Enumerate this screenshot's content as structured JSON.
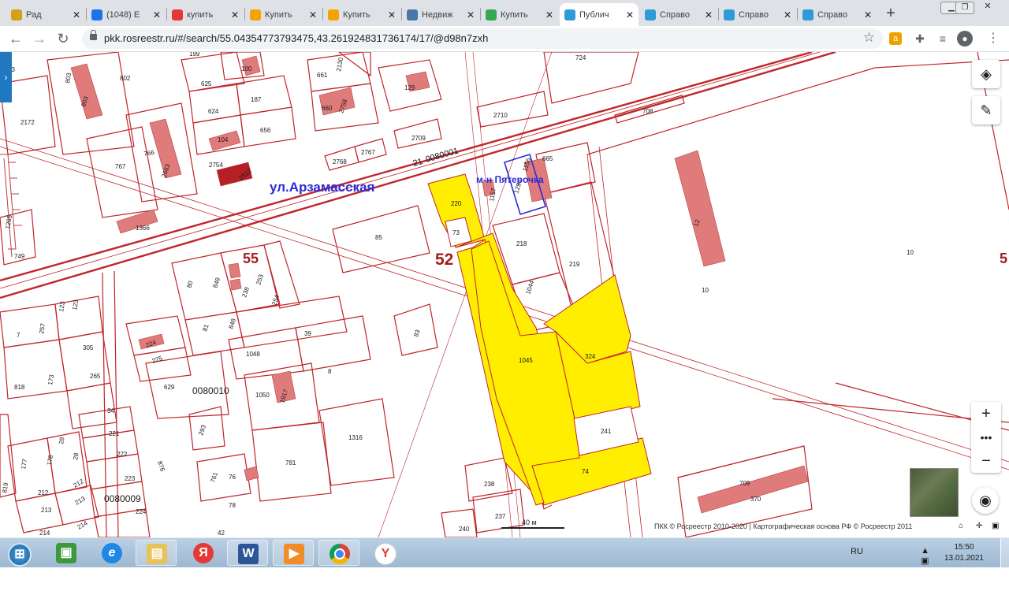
{
  "tabs": [
    {
      "label": "Рад",
      "icon_color": "#d4a017",
      "icon": "audio-tab-icon"
    },
    {
      "label": "(1048) E",
      "icon_color": "#1a73e8",
      "icon": "mail-icon"
    },
    {
      "label": "купить",
      "icon_color": "#e53935",
      "icon": "yandex-icon"
    },
    {
      "label": "Купить",
      "icon_color": "#f4a300",
      "icon": "house-icon"
    },
    {
      "label": "Купить",
      "icon_color": "#f4a300",
      "icon": "house-icon"
    },
    {
      "label": "Недвиж",
      "icon_color": "#4a76a8",
      "icon": "vk-icon"
    },
    {
      "label": "Купить",
      "icon_color": "#34a853",
      "icon": "grid-icon"
    },
    {
      "label": "Публич",
      "icon_color": "#2e9bd6",
      "icon": "rosreestr-icon"
    },
    {
      "label": "Справо",
      "icon_color": "#2e9bd6",
      "icon": "rosreestr-icon"
    },
    {
      "label": "Справо",
      "icon_color": "#2e9bd6",
      "icon": "rosreestr-icon"
    },
    {
      "label": "Справо",
      "icon_color": "#2e9bd6",
      "icon": "rosreestr-icon"
    }
  ],
  "active_tab_index": 7,
  "toolbar": {
    "url": "pkk.rosreestr.ru/#/search/55.04354773793475,43.261924831736174/17/@d98n7zxh"
  },
  "map": {
    "street_label": "ул.Арзамасская",
    "shop_label": "м-н Пятерочка",
    "quarter_labels": [
      "0080001",
      "0080010",
      "0080009"
    ],
    "big_numbers": [
      "52",
      "55",
      "5"
    ],
    "parcels": [
      "220",
      "73",
      "1157",
      "1156",
      "1294",
      "665",
      "218",
      "219",
      "1044",
      "1045",
      "324",
      "241",
      "74",
      "238",
      "237",
      "240",
      "85",
      "83",
      "12",
      "10",
      "10",
      "709",
      "370",
      "708",
      "2710",
      "724",
      "2709",
      "2768",
      "2767",
      "129",
      "661",
      "660",
      "2758",
      "2130",
      "625",
      "624",
      "187",
      "656",
      "100",
      "104",
      "2754",
      "2512",
      "802",
      "803",
      "767",
      "766",
      "2663",
      "2172",
      "1265",
      "749",
      "1366",
      "849",
      "80",
      "238",
      "253",
      "254",
      "55",
      "81",
      "848",
      "39",
      "1048",
      "8",
      "1050",
      "1917",
      "1316",
      "781",
      "629",
      "293",
      "761",
      "76",
      "78",
      "42",
      "224",
      "225",
      "305",
      "265",
      "7",
      "257",
      "123",
      "123",
      "818",
      "173",
      "34",
      "221",
      "222",
      "223",
      "224",
      "177",
      "178",
      "28",
      "28",
      "212",
      "212",
      "213",
      "213",
      "214",
      "214",
      "876",
      "819",
      "193",
      "199",
      "2754"
    ],
    "scale_label": "40 м",
    "copyright": "ПКК © Росреестр 2010-2020 | Картографическая основа РФ © Росреестр 2011"
  },
  "taskbar": {
    "lang": "RU",
    "time": "15:50",
    "date": "13.01.2021"
  },
  "colors": {
    "parcel_line": "#c0252a",
    "selected_fill": "#ffee00",
    "building": "#e07b7b",
    "highlight_box": "#2b2bd6",
    "street_text": "#2b2bd6"
  }
}
